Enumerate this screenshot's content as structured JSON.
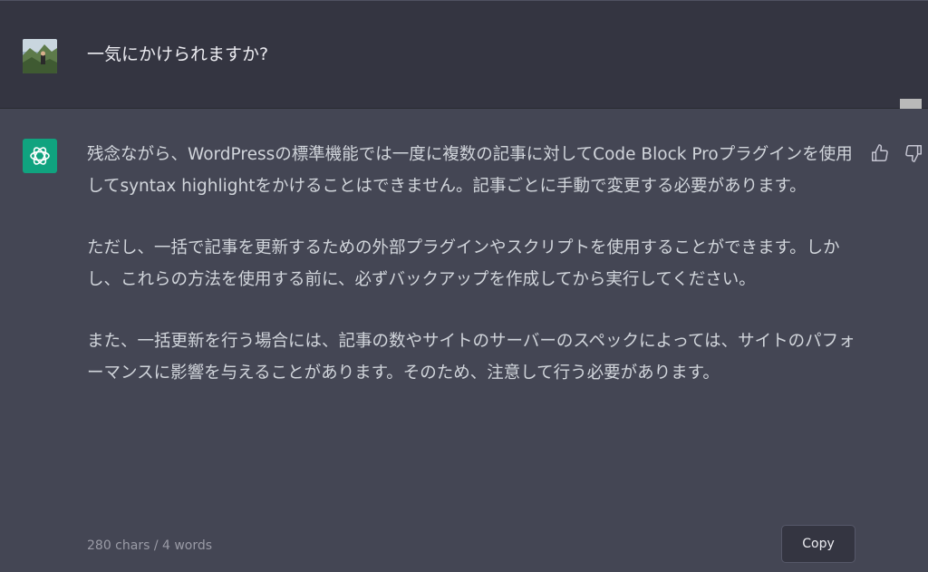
{
  "user": {
    "message": "一気にかけられますか?"
  },
  "assistant": {
    "paragraphs": [
      "残念ながら、WordPressの標準機能では一度に複数の記事に対してCode Block Proプラグインを使用してsyntax highlightをかけることはできません。記事ごとに手動で変更する必要があります。",
      "ただし、一括で記事を更新するための外部プラグインやスクリプトを使用することができます。しかし、これらの方法を使用する前に、必ずバックアップを作成してから実行してください。",
      "また、一括更新を行う場合には、記事の数やサイトのサーバーのスペックによっては、サイトのパフォーマンスに影響を与えることがあります。そのため、注意して行う必要があります。"
    ],
    "stats": "280 chars / 4 words",
    "copy_label": "Copy"
  },
  "icons": {
    "bot_avatar": "openai-logo-icon",
    "user_avatar": "user-photo-avatar",
    "bookmark": "bookmark-icon",
    "like": "thumbs-up-icon",
    "dislike": "thumbs-down-icon"
  },
  "colors": {
    "user_bg": "#343541",
    "assistant_bg": "#444654",
    "bot_accent": "#10a37f",
    "text": "#d1d5db"
  }
}
